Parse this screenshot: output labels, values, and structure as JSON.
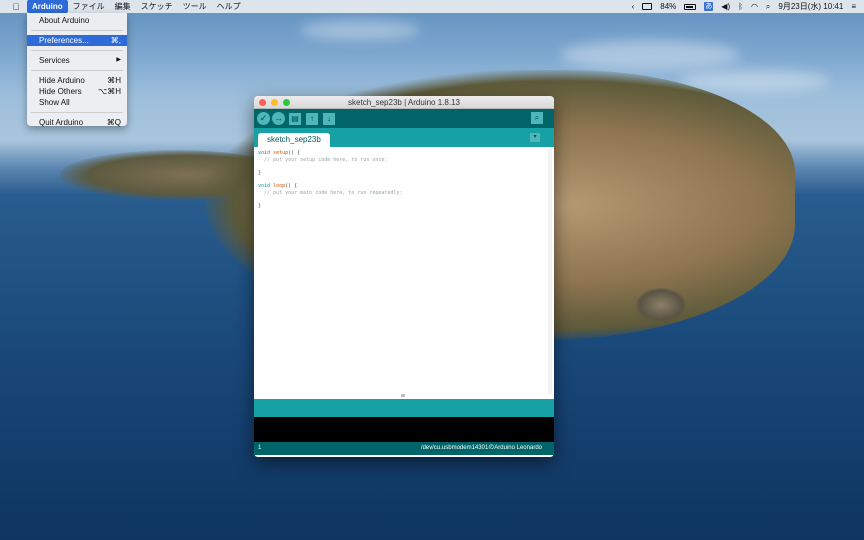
{
  "menubar": {
    "app_name": "Arduino",
    "menus": [
      "ファイル",
      "編集",
      "スケッチ",
      "ツール",
      "ヘルプ"
    ],
    "battery": "84%",
    "ime": "あ",
    "datetime": "9月23日(水)  10:41"
  },
  "app_menu": {
    "about": "About Arduino",
    "preferences": "Preferences...",
    "preferences_shortcut": "⌘,",
    "services": "Services",
    "services_arrow": "▶",
    "hide": "Hide Arduino",
    "hide_shortcut": "⌘H",
    "hide_others": "Hide Others",
    "hide_others_shortcut": "⌥⌘H",
    "show_all": "Show All",
    "quit": "Quit Arduino",
    "quit_shortcut": "⌘Q"
  },
  "window": {
    "title": "sketch_sep23b | Arduino 1.8.13",
    "tab_name": "sketch_sep23b",
    "tab_menu_icon": "▾",
    "code": {
      "setup_kw": "void",
      "setup_fn": "setup",
      "setup_rest": "() {",
      "setup_comment": "  // put your setup code here, to run once:",
      "close1": "}",
      "loop_kw": "void",
      "loop_fn": "loop",
      "loop_rest": "() {",
      "loop_comment": "  // put your main code here, to run repeatedly:",
      "close2": "}"
    },
    "status": {
      "line": "1",
      "port": "/dev/cu.usbmodem14301のArduino Leonardo"
    }
  },
  "icons": {
    "apple": "apple-logo-icon",
    "verify": "checkmark-icon",
    "upload": "arrow-right-icon",
    "new": "new-file-icon",
    "open": "open-up-arrow-icon",
    "save": "save-down-arrow-icon",
    "serial": "magnifier-icon"
  },
  "colors": {
    "arduino_dark_teal": "#006468",
    "arduino_teal": "#17a1a5",
    "menu_highlight": "#2c6bd8"
  }
}
